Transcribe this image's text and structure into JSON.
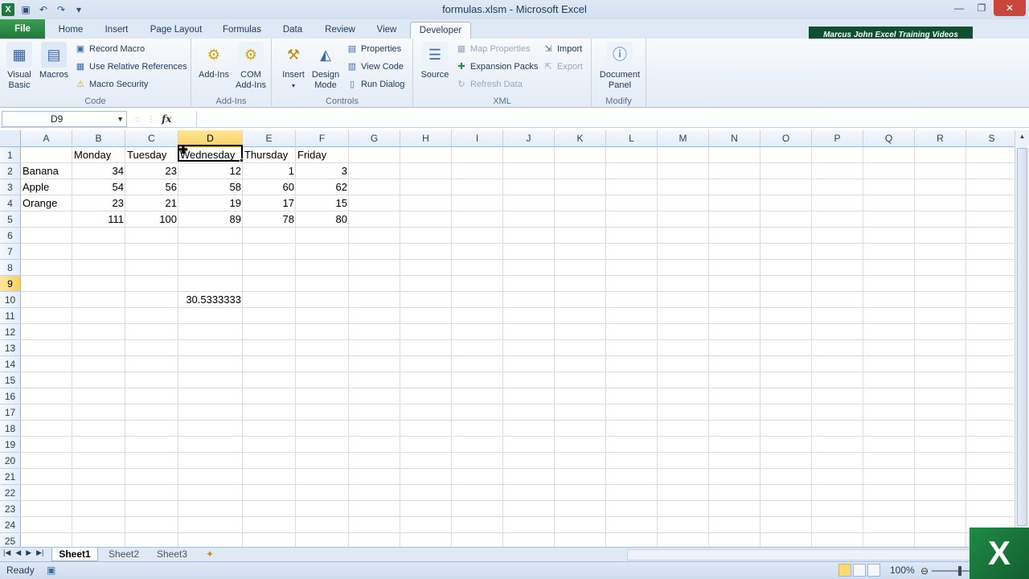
{
  "window": {
    "title": "formulas.xlsm  -  Microsoft Excel"
  },
  "ribbon": {
    "tabs": [
      "File",
      "Home",
      "Insert",
      "Page Layout",
      "Formulas",
      "Data",
      "Review",
      "View",
      "Developer"
    ],
    "active_tab": "Developer",
    "banner": "Marcus John Excel Training Videos",
    "groups": {
      "code": {
        "label": "Code",
        "visual_basic": "Visual Basic",
        "macros": "Macros",
        "record_macro": "Record Macro",
        "use_relative_references": "Use Relative References",
        "macro_security": "Macro Security"
      },
      "addins": {
        "label": "Add-Ins",
        "add_ins": "Add-Ins",
        "com_add_ins": "COM Add-Ins"
      },
      "controls": {
        "label": "Controls",
        "insert": "Insert",
        "design_mode": "Design Mode",
        "properties": "Properties",
        "view_code": "View Code",
        "run_dialog": "Run Dialog"
      },
      "xml": {
        "label": "XML",
        "source": "Source",
        "map_properties": "Map Properties",
        "expansion_packs": "Expansion Packs",
        "refresh_data": "Refresh Data",
        "import": "Import",
        "export": "Export"
      },
      "modify": {
        "label": "Modify",
        "document_panel": "Document Panel"
      }
    }
  },
  "formula_bar": {
    "name_box": "D9",
    "fx": "fx",
    "formula": ""
  },
  "sheet": {
    "columns": [
      "A",
      "B",
      "C",
      "D",
      "E",
      "F",
      "G",
      "H",
      "I",
      "J",
      "K",
      "L",
      "M",
      "N",
      "O",
      "P",
      "Q",
      "R",
      "S"
    ],
    "selected_column": "D",
    "selected_row": 9,
    "row_count": 25,
    "cells": {
      "B1": "Monday",
      "C1": "Tuesday",
      "D1": "Wednesday",
      "E1": "Thursday",
      "F1": "Friday",
      "A2": "Banana",
      "B2": "34",
      "C2": "23",
      "D2": "12",
      "E2": "1",
      "F2": "3",
      "A3": "Apple",
      "B3": "54",
      "C3": "56",
      "D3": "58",
      "E3": "60",
      "F3": "62",
      "A4": "Orange",
      "B4": "23",
      "C4": "21",
      "D4": "19",
      "E4": "17",
      "F4": "15",
      "B5": "111",
      "C5": "100",
      "D5": "89",
      "E5": "78",
      "F5": "80",
      "D10": "30.5333333"
    }
  },
  "sheet_tabs": [
    "Sheet1",
    "Sheet2",
    "Sheet3"
  ],
  "active_sheet": "Sheet1",
  "status": {
    "ready": "Ready",
    "zoom": "100%"
  }
}
